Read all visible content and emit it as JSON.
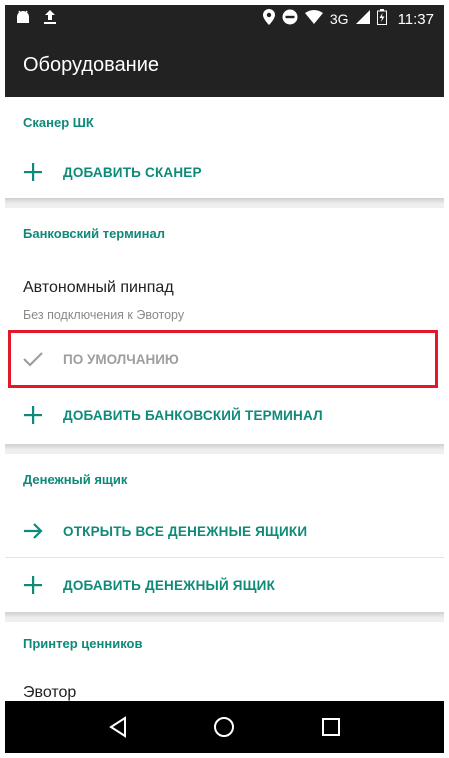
{
  "status_bar": {
    "network": "3G",
    "time": "11:37"
  },
  "app_bar": {
    "title": "Оборудование"
  },
  "sections": {
    "scanner": {
      "title": "Сканер ШК",
      "add_label": "ДОБАВИТЬ СКАНЕР"
    },
    "bank_terminal": {
      "title": "Банковский терминал",
      "device_name": "Автономный пинпад",
      "device_status": "Без подключения к Эвотору",
      "default_label": "ПО УМОЛЧАНИЮ",
      "add_label": "ДОБАВИТЬ БАНКОВСКИЙ ТЕРМИНАЛ"
    },
    "cash_drawer": {
      "title": "Денежный ящик",
      "open_all_label": "ОТКРЫТЬ ВСЕ ДЕНЕЖНЫЕ ЯЩИКИ",
      "add_label": "ДОБАВИТЬ ДЕНЕЖНЫЙ ЯЩИК"
    },
    "price_printer": {
      "title": "Принтер ценников",
      "device_name": "Эвотор"
    }
  },
  "colors": {
    "accent": "#0e8a78",
    "bar": "#222222",
    "highlight": "#e0182a",
    "muted": "#9e9e9e"
  },
  "icons": {
    "add": "plus-icon",
    "open": "arrow-right-icon",
    "default": "check-icon",
    "back": "back-triangle-icon",
    "home": "home-circle-icon",
    "recents": "recents-square-icon"
  }
}
